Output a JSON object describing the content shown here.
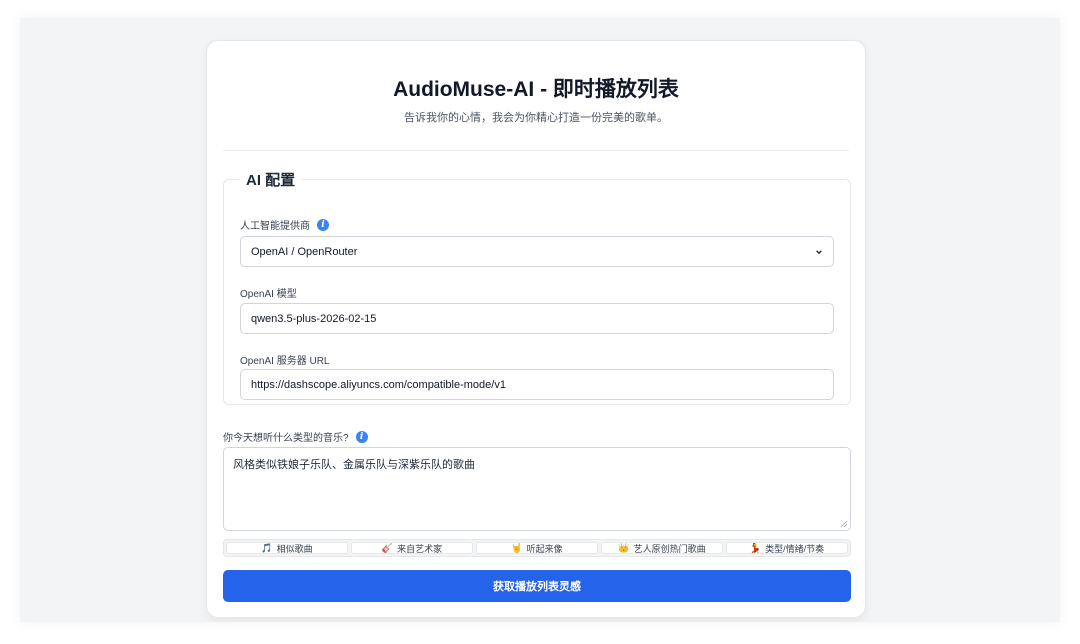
{
  "header": {
    "title": "AudioMuse-AI - 即时播放列表",
    "subtitle": "告诉我你的心情，我会为你精心打造一份完美的歌单。"
  },
  "ai_config": {
    "legend": "AI 配置",
    "provider": {
      "label": "人工智能提供商",
      "info_icon": "info-icon",
      "selected": "OpenAI / OpenRouter"
    },
    "model": {
      "label": "OpenAI 模型",
      "value": "qwen3.5-plus-2026-02-15"
    },
    "server_url": {
      "label": "OpenAI 服务器 URL",
      "value": "https://dashscope.aliyuncs.com/compatible-mode/v1"
    }
  },
  "prompt": {
    "label": "你今天想听什么类型的音乐?",
    "info_icon": "info-icon",
    "value": "风格类似铁娘子乐队、金属乐队与深紫乐队的歌曲"
  },
  "chips": [
    {
      "icon": "🎵",
      "icon_name": "music-note-icon",
      "label": "相似歌曲"
    },
    {
      "icon": "🎸",
      "icon_name": "guitar-icon",
      "label": "来自艺术家"
    },
    {
      "icon": "🤘",
      "icon_name": "rock-hand-icon",
      "label": "听起来像"
    },
    {
      "icon": "👑",
      "icon_name": "crown-icon",
      "label": "艺人原创热门歌曲"
    },
    {
      "icon": "💃",
      "icon_name": "dancer-icon",
      "label": "类型/情绪/节奏"
    }
  ],
  "submit": {
    "label": "获取播放列表灵感"
  },
  "colors": {
    "accent": "#2563eb",
    "info": "#3b82f6",
    "page_bg": "#f3f4f6"
  }
}
